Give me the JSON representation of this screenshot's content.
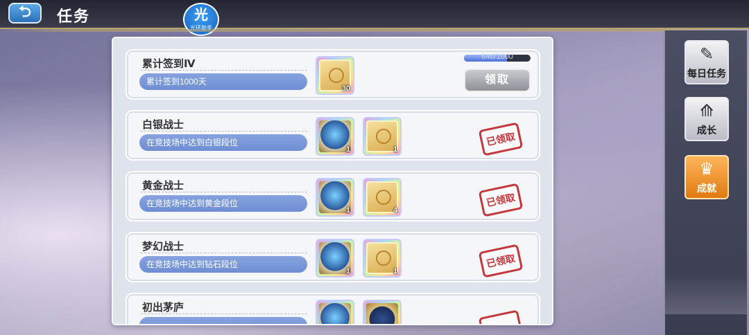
{
  "header": {
    "back_icon": "back-arrow-icon",
    "title": "任务",
    "helper_badge": {
      "glyph": "光",
      "text": "光环助手"
    }
  },
  "tasks": [
    {
      "title": "累计签到Ⅳ",
      "desc": "累计签到1000天",
      "rewards": [
        {
          "icon": "gold-card-icon",
          "count": "30"
        }
      ],
      "progress_text": "646/1000",
      "progress": 0.646,
      "button": "领取",
      "status": "unclaimed"
    },
    {
      "title": "白银战士",
      "desc": "在竞技场中达到白银段位",
      "rewards": [
        {
          "icon": "shield-icon",
          "count": "1"
        },
        {
          "icon": "gold-card-icon",
          "count": "1"
        }
      ],
      "stamp": "已领取",
      "status": "claimed"
    },
    {
      "title": "黄金战士",
      "desc": "在竞技场中达到黄金段位",
      "rewards": [
        {
          "icon": "shield-icon",
          "count": "1"
        },
        {
          "icon": "gold-card-icon",
          "count": "4"
        }
      ],
      "stamp": "已领取",
      "status": "claimed"
    },
    {
      "title": "梦幻战士",
      "desc": "在竞技场中达到钻石段位",
      "rewards": [
        {
          "icon": "shield-icon",
          "count": "1"
        },
        {
          "icon": "gold-card-icon",
          "count": "1"
        }
      ],
      "stamp": "已领取",
      "status": "claimed"
    },
    {
      "title": "初出茅庐",
      "rewards": [
        {
          "icon": "shield-icon"
        },
        {
          "icon": "emblem-icon"
        }
      ],
      "status": "claimed"
    }
  ],
  "sidebar": {
    "items": [
      {
        "label": "每日任务",
        "icon": "daily-task-icon",
        "active": false
      },
      {
        "label": "成长",
        "icon": "growth-icon",
        "active": false
      },
      {
        "label": "成就",
        "icon": "achievement-icon",
        "active": true
      }
    ]
  },
  "colors": {
    "accent": "#e07a12",
    "stamp": "#c4373a",
    "desc_pill": "#7a96d8",
    "topbar": "#2b2d3a"
  }
}
